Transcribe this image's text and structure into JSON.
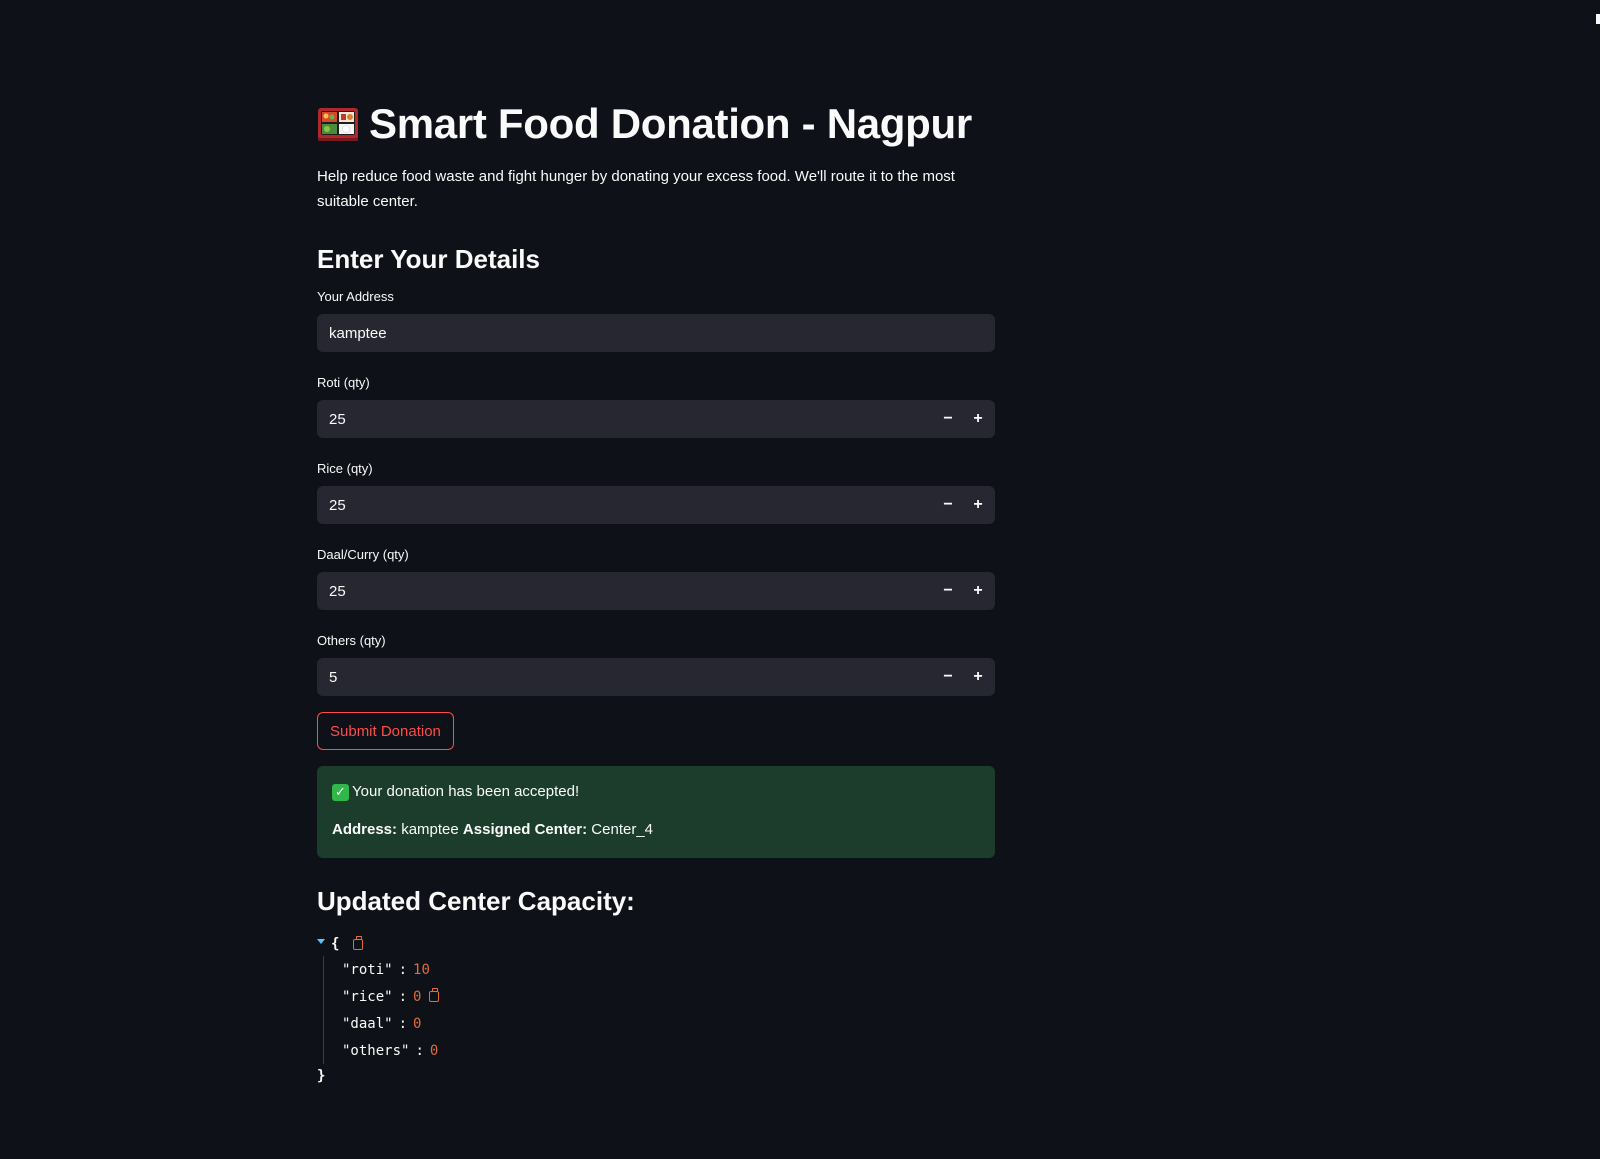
{
  "header": {
    "title": "Smart Food Donation - Nagpur",
    "title_icon": "bento-box-icon",
    "intro": "Help reduce food waste and fight hunger by donating your excess food. We'll route it to the most suitable center."
  },
  "form": {
    "section_title": "Enter Your Details",
    "address": {
      "label": "Your Address",
      "value": "kamptee"
    },
    "roti": {
      "label": "Roti (qty)",
      "value": "25"
    },
    "rice": {
      "label": "Rice (qty)",
      "value": "25"
    },
    "daal": {
      "label": "Daal/Curry (qty)",
      "value": "25"
    },
    "others": {
      "label": "Others (qty)",
      "value": "5"
    },
    "decrement_symbol": "−",
    "increment_symbol": "+",
    "submit_label": "Submit Donation"
  },
  "result": {
    "message": "Your donation has been accepted!",
    "address_label": "Address:",
    "address_value": "kamptee",
    "center_label": "Assigned Center:",
    "center_value": "Center_4"
  },
  "capacity": {
    "title": "Updated Center Capacity:",
    "open_brace": "{",
    "close_brace": "}",
    "colon": ":",
    "entries": [
      {
        "key": "\"roti\"",
        "value": "10"
      },
      {
        "key": "\"rice\"",
        "value": "0"
      },
      {
        "key": "\"daal\"",
        "value": "0"
      },
      {
        "key": "\"others\"",
        "value": "0"
      }
    ]
  },
  "colors": {
    "background": "#0e1117",
    "input_bg": "#262730",
    "accent": "#ff4b4b",
    "success_bg": "#1c3d2b",
    "json_value": "#e06c3c"
  }
}
